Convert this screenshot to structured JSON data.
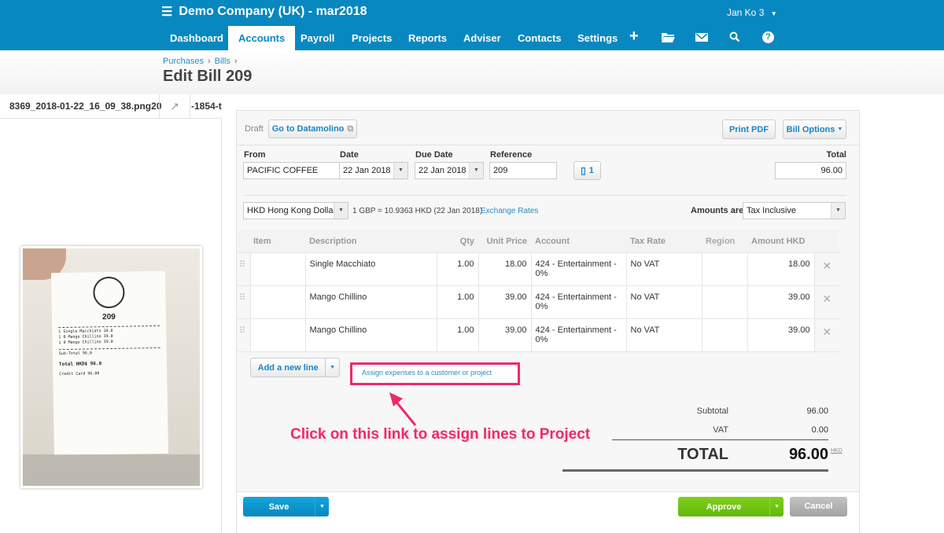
{
  "app": {
    "title": "Demo Company (UK) - mar2018",
    "user": "Jan Ko 3"
  },
  "nav": [
    "Dashboard",
    "Accounts",
    "Payroll",
    "Projects",
    "Reports",
    "Adviser",
    "Contacts",
    "Settings"
  ],
  "nav_icons": [
    "plus-icon",
    "folder-icon",
    "mail-icon",
    "search-icon",
    "help-icon"
  ],
  "breadcrumb": [
    "Purchases",
    "Bills"
  ],
  "page_title": "Edit Bill 209",
  "file": {
    "name": "8369_2018-01-22_16_09_38.png20",
    "next": "-1854-t"
  },
  "receipt": {
    "number": "209",
    "lines": [
      "1 Single Macchiato  18.0",
      "1 0  Mango Chillino  39.0",
      "1 0  Mango Chillino  39.0"
    ],
    "subtotal": "Sub-Total  96.0",
    "total": "Total  HKD$  96.0",
    "card": "Credit Card  96.00"
  },
  "bill": {
    "status": "Draft",
    "datamolino": "Go to Datamolino",
    "print": "Print PDF",
    "options": "Bill Options",
    "from_label": "From",
    "from": "PACIFIC COFFEE",
    "date_label": "Date",
    "date": "22 Jan 2018",
    "due_label": "Due Date",
    "due": "22 Jan 2018",
    "ref_label": "Reference",
    "ref": "209",
    "attach_count": "1",
    "total_label": "Total",
    "total": "96.00",
    "currency": "HKD Hong Kong Dollar",
    "rate": "1 GBP = 10.9363  HKD  (22 Jan 2018)",
    "rates_link": "Exchange Rates",
    "amounts_label": "Amounts are",
    "amounts": "Tax Inclusive"
  },
  "table": {
    "headers": [
      "Item",
      "Description",
      "Qty",
      "Unit Price",
      "Account",
      "Tax Rate",
      "Region",
      "Amount HKD"
    ],
    "rows": [
      {
        "item": "",
        "desc": "Single Macchiato",
        "qty": "1.00",
        "price": "18.00",
        "account": "424 - Entertainment - 0%",
        "tax": "No VAT",
        "region": "",
        "amount": "18.00"
      },
      {
        "item": "",
        "desc": "Mango Chillino",
        "qty": "1.00",
        "price": "39.00",
        "account": "424 - Entertainment - 0%",
        "tax": "No VAT",
        "region": "",
        "amount": "39.00"
      },
      {
        "item": "",
        "desc": "Mango Chillino",
        "qty": "1.00",
        "price": "39.00",
        "account": "424 - Entertainment - 0%",
        "tax": "No VAT",
        "region": "",
        "amount": "39.00"
      }
    ]
  },
  "add_line": "Add a new line",
  "assign_link": "Assign expenses to a customer or project",
  "annotation": "Click on this link to assign lines to Project",
  "totals": {
    "subtotal_label": "Subtotal",
    "subtotal": "96.00",
    "vat_label": "VAT",
    "vat": "0.00",
    "total_label": "TOTAL",
    "total": "96.00",
    "currency": "HKD"
  },
  "footer": {
    "save": "Save",
    "approve": "Approve",
    "cancel": "Cancel"
  },
  "colors": {
    "brand": "#0888c0",
    "approve": "#6cc212",
    "annotation": "#f0286e"
  }
}
